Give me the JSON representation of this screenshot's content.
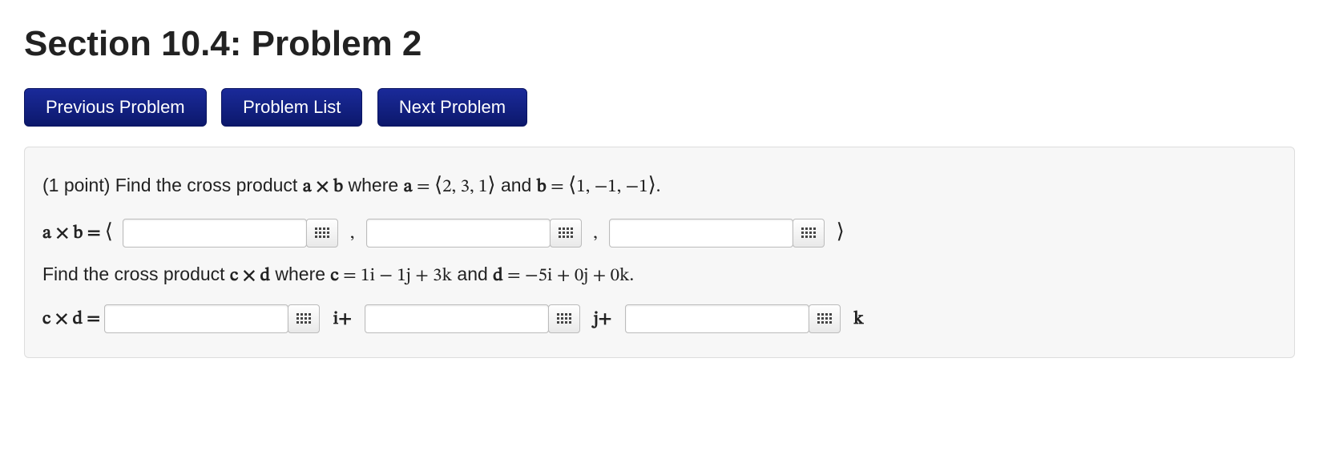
{
  "title": "Section 10.4: Problem 2",
  "nav": {
    "prev": "Previous Problem",
    "list": "Problem List",
    "next": "Next Problem"
  },
  "problem": {
    "points_prefix": "(1 point) ",
    "part1_text_a": "Find the cross product ",
    "axb": "a × b",
    "part1_where": " where ",
    "a_eq": "a",
    "eq": " = ",
    "a_vec_open": "⟨",
    "a_vec": "2, 3, 1",
    "a_vec_close": "⟩",
    "and": " and ",
    "b_eq": "b",
    "b_vec": "1, −1, −1",
    "period": ".",
    "line2_prefix": "a × b = ",
    "open_angle": "⟨",
    "comma": " ,",
    "close_angle": "⟩",
    "part2_text": "Find the cross product ",
    "cxd": "c × d",
    "c_eq": "c",
    "c_expr": " = 1i − 1j + 3k",
    "d_eq": "d",
    "d_expr": " = −5i + 0j + 0k",
    "line4_prefix": "c × d = ",
    "i_plus": " i+",
    "j_plus": " j+",
    "k_lbl": " k"
  }
}
